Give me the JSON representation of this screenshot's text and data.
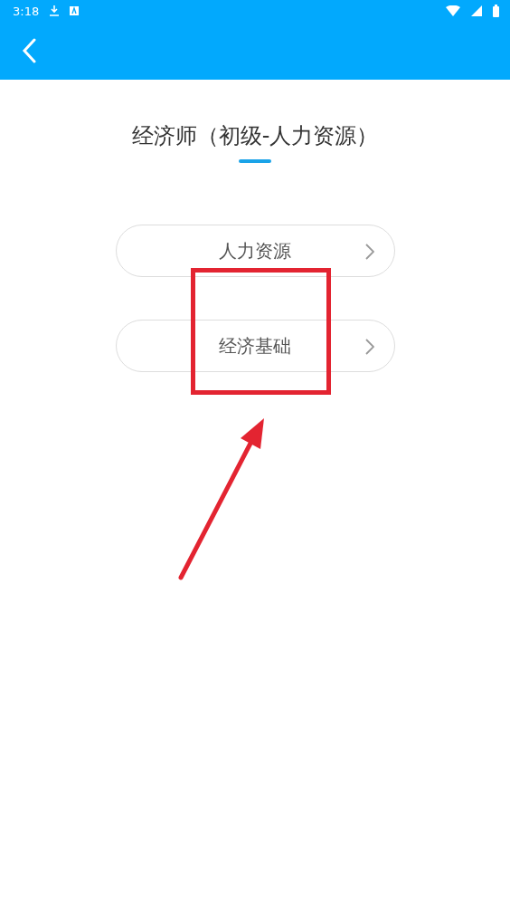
{
  "status_bar": {
    "time": "3:18"
  },
  "page": {
    "title": "经济师（初级-人力资源）"
  },
  "subjects": [
    {
      "label": "人力资源"
    },
    {
      "label": "经济基础"
    }
  ]
}
